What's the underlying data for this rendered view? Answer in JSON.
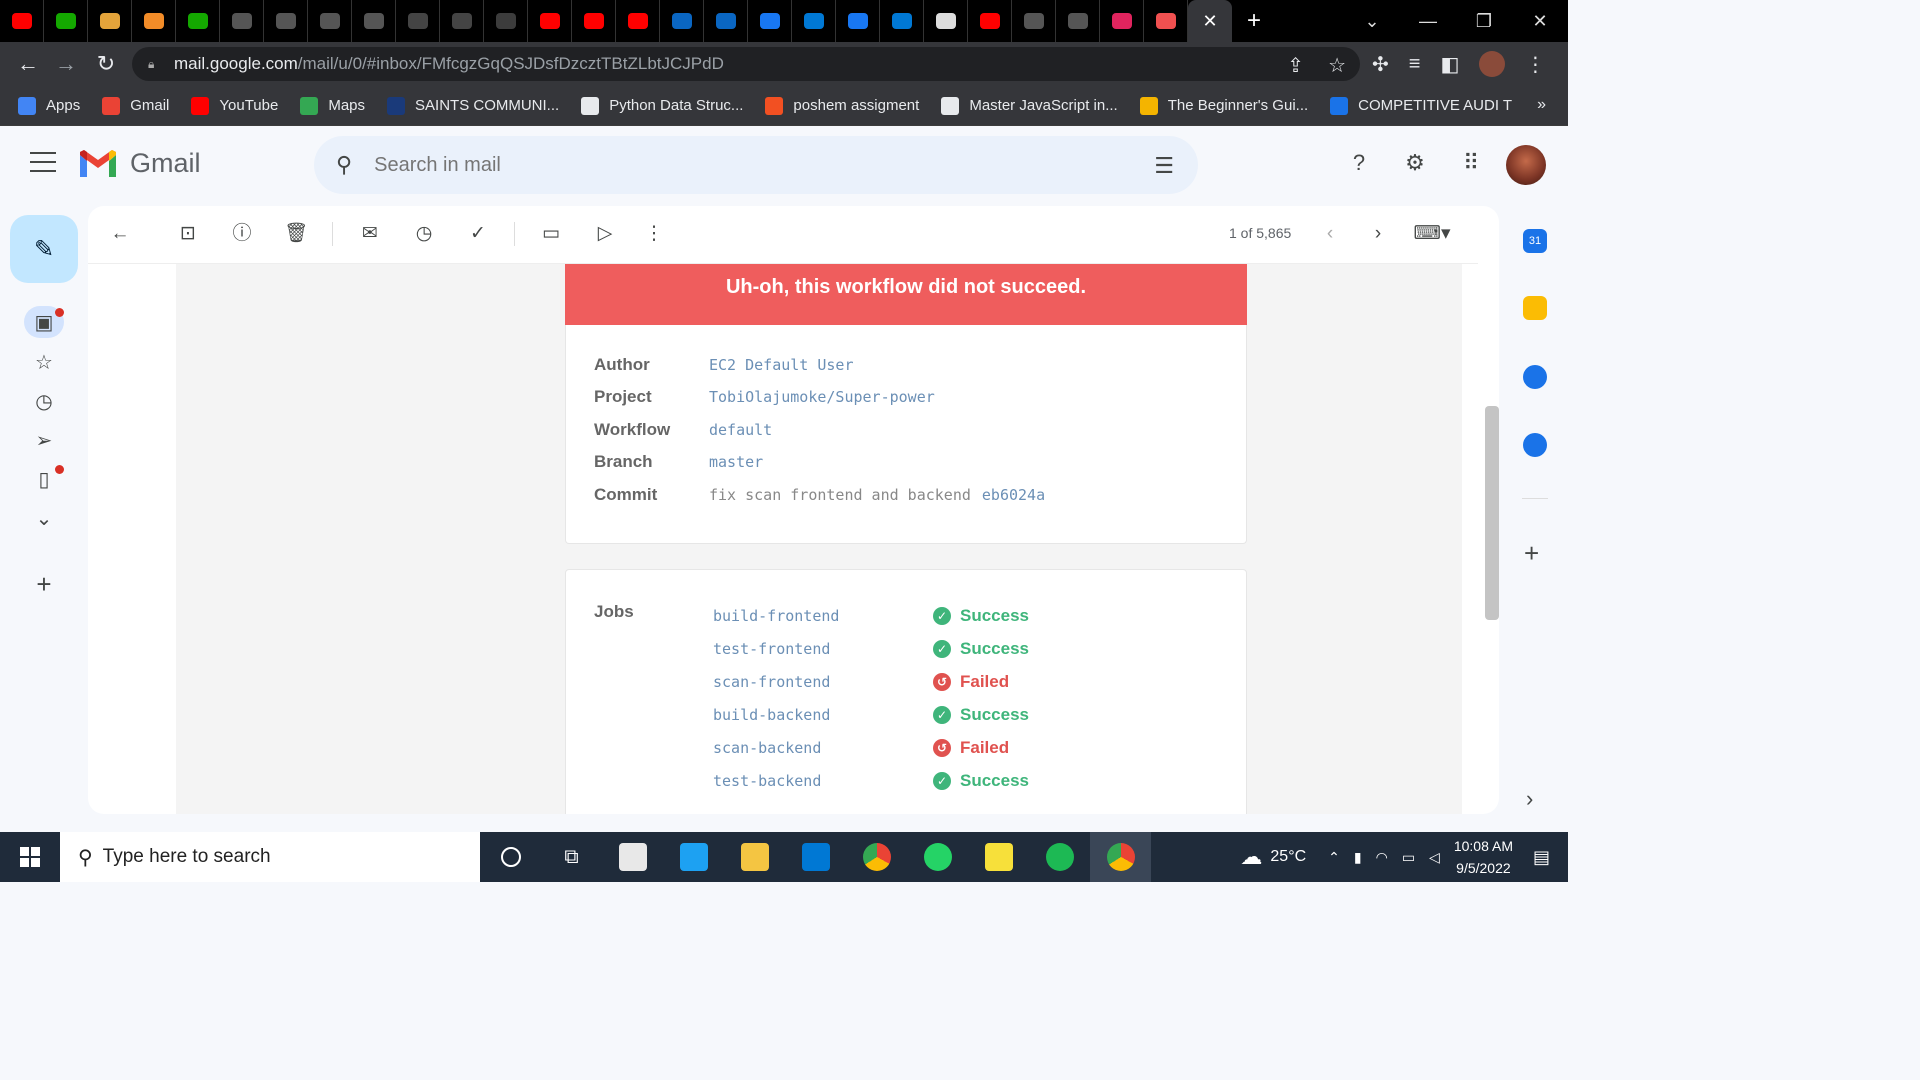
{
  "browser": {
    "tabs_favicons": [
      "youtube-icon",
      "upwork-icon",
      "package-icon",
      "box-icon",
      "upwork-icon",
      "github-icon",
      "github-icon",
      "github-icon",
      "github-icon",
      "refresh-icon",
      "refresh-icon",
      "ai-icon",
      "youtube-icon",
      "youtube-icon",
      "youtube-icon",
      "linkedin-learning-icon",
      "linkedin-icon",
      "messenger-icon",
      "mail-icon",
      "messenger-icon",
      "mail-icon",
      "chrome-icon",
      "youtube-icon",
      "github-icon",
      "github-icon",
      "stripes-icon",
      "record-icon"
    ],
    "active_tab_close": "✕",
    "new_tab": "+",
    "url_host": "mail.google.com",
    "url_path": "/mail/u/0/#inbox/FMfcgzGqQSJDsfDzcztTBtZLbtJCJPdD",
    "bookmarks": [
      {
        "label": "Apps",
        "color": "#4285f4"
      },
      {
        "label": "Gmail",
        "color": "#ea4335"
      },
      {
        "label": "YouTube",
        "color": "#ff0000"
      },
      {
        "label": "Maps",
        "color": "#34a853"
      },
      {
        "label": "SAINTS COMMUNI...",
        "color": "#1a3a7a"
      },
      {
        "label": "Python  Data Struc...",
        "color": "#e8eaed"
      },
      {
        "label": "poshem assigment",
        "color": "#f25022"
      },
      {
        "label": "Master JavaScript in...",
        "color": "#e8eaed"
      },
      {
        "label": "The Beginner's Gui...",
        "color": "#f4b400"
      },
      {
        "label": "COMPETITIVE AUDI T",
        "color": "#1a73e8"
      }
    ],
    "bookmarks_more": "»"
  },
  "gmail": {
    "brand": "Gmail",
    "search_placeholder": "Search in mail",
    "pager": "1 of 5,865",
    "email": {
      "banner": "Uh-oh, this workflow did not succeed.",
      "fields": [
        {
          "label": "Author",
          "value": "EC2 Default User",
          "extra": ""
        },
        {
          "label": "Project",
          "value": "TobiOlajumoke/Super-power",
          "extra": ""
        },
        {
          "label": "Workflow",
          "value": "default",
          "extra": ""
        },
        {
          "label": "Branch",
          "value": "master",
          "extra": ""
        },
        {
          "label": "Commit",
          "value": "fix scan frontend and backend",
          "extra": "eb6024a"
        }
      ],
      "jobs_label": "Jobs",
      "jobs": [
        {
          "name": "build-frontend",
          "status": "Success"
        },
        {
          "name": "test-frontend",
          "status": "Success"
        },
        {
          "name": "scan-frontend",
          "status": "Failed"
        },
        {
          "name": "build-backend",
          "status": "Success"
        },
        {
          "name": "scan-backend",
          "status": "Failed"
        },
        {
          "name": "test-backend",
          "status": "Success"
        }
      ]
    }
  },
  "colors": {
    "success": "#3fb57b",
    "failed": "#e0524f",
    "banner": "#ef5d5d",
    "link": "#6b8fb5"
  },
  "taskbar": {
    "search_placeholder": "Type here to search",
    "weather": "25°C",
    "time": "10:08 AM",
    "date": "9/5/2022"
  }
}
